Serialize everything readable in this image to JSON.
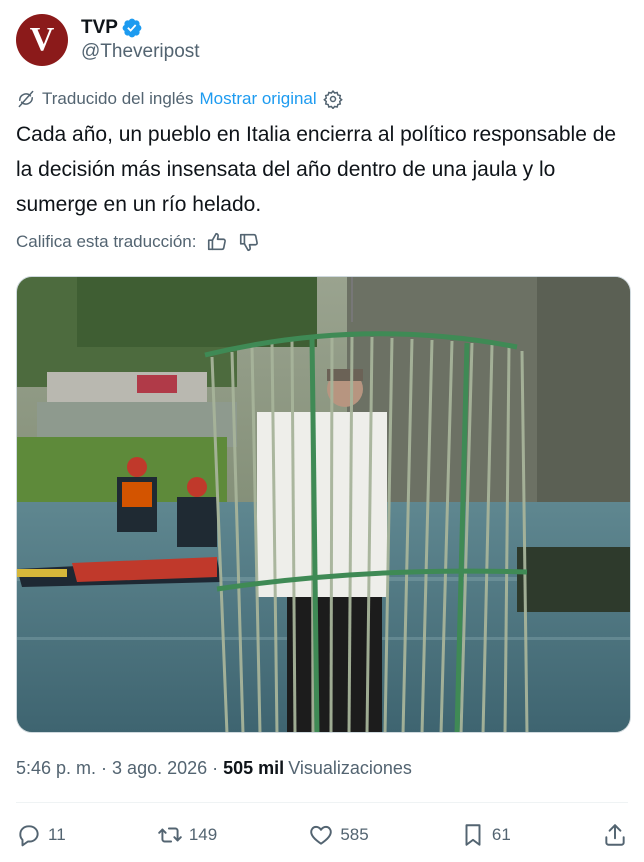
{
  "author": {
    "avatar_letter": "V",
    "display_name": "TVP",
    "handle": "@Theveripost",
    "avatar_color": "#8b1a1a",
    "verified_color": "#1d9bf0"
  },
  "translation": {
    "label": "Traducido del inglés",
    "show_original": "Mostrar original"
  },
  "tweet": {
    "text": "Cada año, un pueblo en Italia encierra al político responsable de la decisión más insensata del año dentro de una jaula y lo sumerge en un río helado."
  },
  "rate_translation": {
    "label": "Califica esta traducción:"
  },
  "meta": {
    "time": "5:46 p. m.",
    "separator": "·",
    "date": "3 ago. 2026",
    "views_count": "505 mil",
    "views_label": "Visualizaciones"
  },
  "actions": {
    "replies": "11",
    "reposts": "149",
    "likes": "585",
    "bookmarks": "61"
  },
  "icons": {
    "translate": "translate-icon",
    "settings": "gear-icon",
    "thumb_up": "thumbs-up-icon",
    "thumb_down": "thumbs-down-icon",
    "reply": "reply-icon",
    "repost": "repost-icon",
    "like": "heart-icon",
    "bookmark": "bookmark-icon",
    "share": "share-icon"
  }
}
